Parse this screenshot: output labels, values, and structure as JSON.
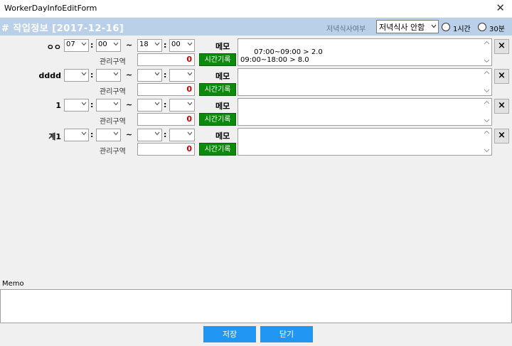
{
  "window": {
    "title": "WorkerDayInfoEditForm",
    "close_glyph": "✕"
  },
  "header": {
    "title": "# 작업정보 [2017-12-16]",
    "dinner_label": "저녁식사여부",
    "dinner_value": "저녁식사 안함",
    "radio_1h": "1시간",
    "radio_30m": "30분"
  },
  "labels": {
    "area": "관리구역",
    "memo": "메모",
    "time_record": "시간기록",
    "delete": "×",
    "colon": ":",
    "tilde": "~"
  },
  "rows": [
    {
      "name": "ㅇㅇ",
      "start_hour": "07",
      "start_min": "00",
      "end_hour": "18",
      "end_min": "00",
      "area_value": "0",
      "memo": "07:00~09:00 > 2.0\n09:00~18:00 > 8.0"
    },
    {
      "name": "dddd",
      "start_hour": "",
      "start_min": "",
      "end_hour": "",
      "end_min": "",
      "area_value": "0",
      "memo": ""
    },
    {
      "name": "1",
      "start_hour": "",
      "start_min": "",
      "end_hour": "",
      "end_min": "",
      "area_value": "0",
      "memo": ""
    },
    {
      "name": "계1",
      "start_hour": "",
      "start_min": "",
      "end_hour": "",
      "end_min": "",
      "area_value": "0",
      "memo": ""
    }
  ],
  "memo_section": {
    "label": "Memo",
    "value": ""
  },
  "buttons": {
    "save": "저장",
    "close": "닫기"
  }
}
